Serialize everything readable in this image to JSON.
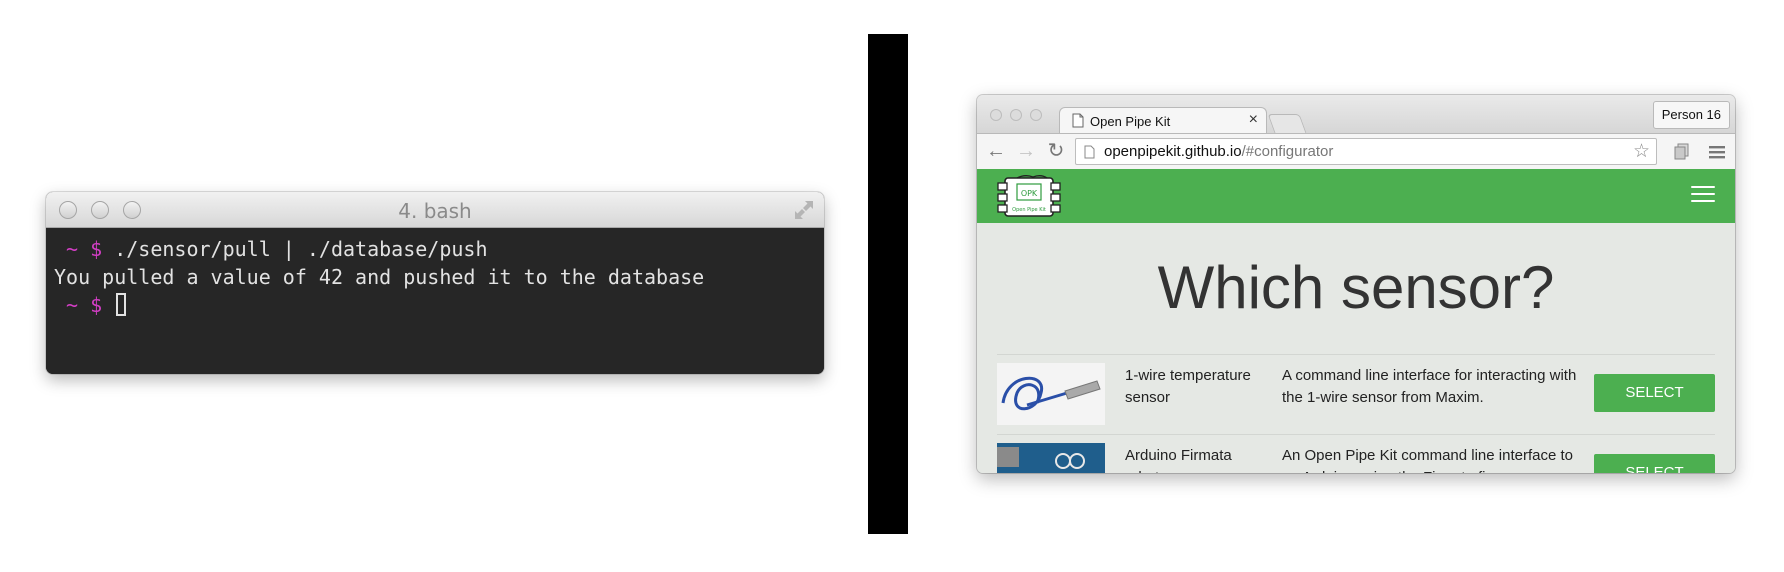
{
  "terminal": {
    "title": "4. bash",
    "lines": [
      {
        "prompt": " ~ $",
        "command": " ./sensor/pull | ./database/push"
      },
      {
        "output": "You pulled a value of 42 and pushed it to the database"
      },
      {
        "prompt": " ~ $",
        "command": " "
      }
    ]
  },
  "browser": {
    "tab_title": "Open Pipe Kit",
    "tab_close": "×",
    "profile_label": "Person 16",
    "url_host": "openpipekit.github.io",
    "url_path": "/#configurator",
    "logo_text_top": "OPK",
    "logo_text_bottom": "Open Pipe Kit",
    "page_heading": "Which sensor?",
    "sensors": [
      {
        "name": "1-wire temperature sensor",
        "description": "A command line interface for interacting with the 1-wire sensor from Maxim.",
        "button_label": "SELECT"
      },
      {
        "name": "Arduino Firmata robot",
        "description": "An Open Pipe Kit command line interface to an Arduino using the Firmata firmware.",
        "button_label": "SELECT"
      }
    ]
  },
  "colors": {
    "brand_green": "#4caf50",
    "terminal_bg": "#262626",
    "prompt_magenta": "#d23ec4"
  },
  "icons": [
    "close-dot",
    "minimize-dot",
    "zoom-dot",
    "expand-icon",
    "page-icon",
    "back-arrow-icon",
    "forward-arrow-icon",
    "reload-icon",
    "star-icon",
    "extensions-icon",
    "menu-icon",
    "hamburger-icon"
  ]
}
